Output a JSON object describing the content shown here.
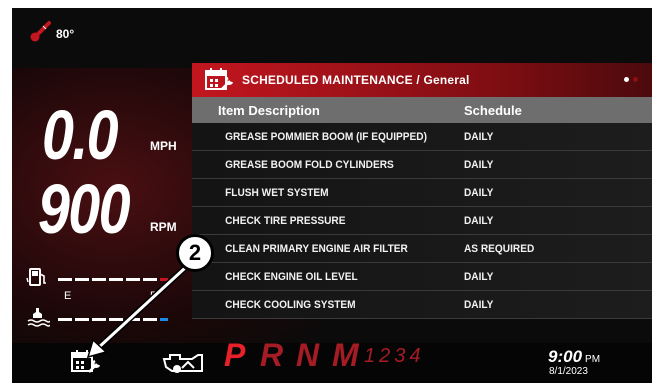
{
  "status": {
    "temperature": "80°"
  },
  "gauges": {
    "speed_value": "0.0",
    "speed_unit": "MPH",
    "rpm_value": "900",
    "rpm_unit": "RPM",
    "tank_empty_label": "E",
    "tank_full_label": "F"
  },
  "panel": {
    "title": "SCHEDULED MAINTENANCE / General",
    "columns": [
      "Item Description",
      "Schedule"
    ],
    "rows": [
      {
        "item": "GREASE POMMIER BOOM (IF EQUIPPED)",
        "schedule": "DAILY"
      },
      {
        "item": "GREASE BOOM FOLD CYLINDERS",
        "schedule": "DAILY"
      },
      {
        "item": "FLUSH WET SYSTEM",
        "schedule": "DAILY"
      },
      {
        "item": "CHECK TIRE PRESSURE",
        "schedule": "DAILY"
      },
      {
        "item": "CLEAN PRIMARY ENGINE AIR FILTER",
        "schedule": "AS REQUIRED"
      },
      {
        "item": "CHECK ENGINE OIL LEVEL",
        "schedule": "DAILY"
      },
      {
        "item": "CHECK COOLING SYSTEM",
        "schedule": "DAILY"
      }
    ]
  },
  "gear": {
    "letters": [
      "P",
      "R",
      "N",
      "M"
    ],
    "numbers": "1234",
    "active_color": "#e8202a",
    "inactive_color": "#a51c24"
  },
  "clock": {
    "time": "9:00",
    "ampm": "PM",
    "date": "8/1/2023"
  },
  "callout": {
    "number": "2"
  },
  "colors": {
    "accent": "#c3161f",
    "coolant_bar": "#1e88e5",
    "fuel_marker": "#c3161f"
  }
}
